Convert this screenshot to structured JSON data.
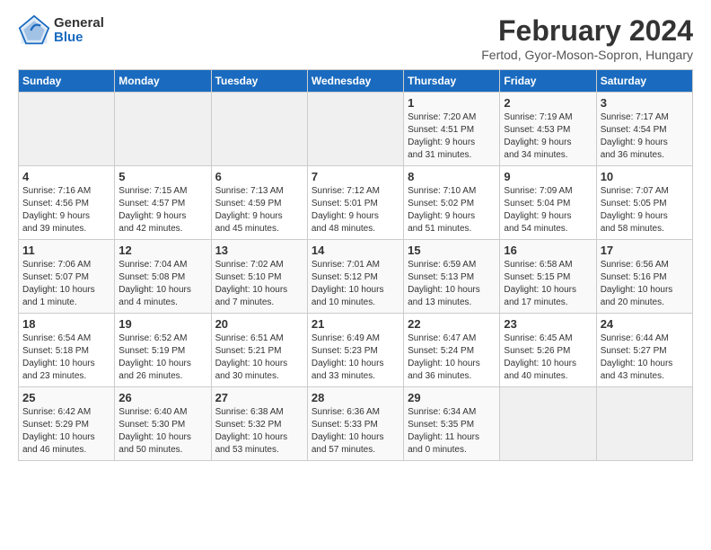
{
  "header": {
    "logo_general": "General",
    "logo_blue": "Blue",
    "title": "February 2024",
    "location": "Fertod, Gyor-Moson-Sopron, Hungary"
  },
  "calendar": {
    "days_of_week": [
      "Sunday",
      "Monday",
      "Tuesday",
      "Wednesday",
      "Thursday",
      "Friday",
      "Saturday"
    ],
    "weeks": [
      [
        {
          "day": "",
          "info": ""
        },
        {
          "day": "",
          "info": ""
        },
        {
          "day": "",
          "info": ""
        },
        {
          "day": "",
          "info": ""
        },
        {
          "day": "1",
          "info": "Sunrise: 7:20 AM\nSunset: 4:51 PM\nDaylight: 9 hours\nand 31 minutes."
        },
        {
          "day": "2",
          "info": "Sunrise: 7:19 AM\nSunset: 4:53 PM\nDaylight: 9 hours\nand 34 minutes."
        },
        {
          "day": "3",
          "info": "Sunrise: 7:17 AM\nSunset: 4:54 PM\nDaylight: 9 hours\nand 36 minutes."
        }
      ],
      [
        {
          "day": "4",
          "info": "Sunrise: 7:16 AM\nSunset: 4:56 PM\nDaylight: 9 hours\nand 39 minutes."
        },
        {
          "day": "5",
          "info": "Sunrise: 7:15 AM\nSunset: 4:57 PM\nDaylight: 9 hours\nand 42 minutes."
        },
        {
          "day": "6",
          "info": "Sunrise: 7:13 AM\nSunset: 4:59 PM\nDaylight: 9 hours\nand 45 minutes."
        },
        {
          "day": "7",
          "info": "Sunrise: 7:12 AM\nSunset: 5:01 PM\nDaylight: 9 hours\nand 48 minutes."
        },
        {
          "day": "8",
          "info": "Sunrise: 7:10 AM\nSunset: 5:02 PM\nDaylight: 9 hours\nand 51 minutes."
        },
        {
          "day": "9",
          "info": "Sunrise: 7:09 AM\nSunset: 5:04 PM\nDaylight: 9 hours\nand 54 minutes."
        },
        {
          "day": "10",
          "info": "Sunrise: 7:07 AM\nSunset: 5:05 PM\nDaylight: 9 hours\nand 58 minutes."
        }
      ],
      [
        {
          "day": "11",
          "info": "Sunrise: 7:06 AM\nSunset: 5:07 PM\nDaylight: 10 hours\nand 1 minute."
        },
        {
          "day": "12",
          "info": "Sunrise: 7:04 AM\nSunset: 5:08 PM\nDaylight: 10 hours\nand 4 minutes."
        },
        {
          "day": "13",
          "info": "Sunrise: 7:02 AM\nSunset: 5:10 PM\nDaylight: 10 hours\nand 7 minutes."
        },
        {
          "day": "14",
          "info": "Sunrise: 7:01 AM\nSunset: 5:12 PM\nDaylight: 10 hours\nand 10 minutes."
        },
        {
          "day": "15",
          "info": "Sunrise: 6:59 AM\nSunset: 5:13 PM\nDaylight: 10 hours\nand 13 minutes."
        },
        {
          "day": "16",
          "info": "Sunrise: 6:58 AM\nSunset: 5:15 PM\nDaylight: 10 hours\nand 17 minutes."
        },
        {
          "day": "17",
          "info": "Sunrise: 6:56 AM\nSunset: 5:16 PM\nDaylight: 10 hours\nand 20 minutes."
        }
      ],
      [
        {
          "day": "18",
          "info": "Sunrise: 6:54 AM\nSunset: 5:18 PM\nDaylight: 10 hours\nand 23 minutes."
        },
        {
          "day": "19",
          "info": "Sunrise: 6:52 AM\nSunset: 5:19 PM\nDaylight: 10 hours\nand 26 minutes."
        },
        {
          "day": "20",
          "info": "Sunrise: 6:51 AM\nSunset: 5:21 PM\nDaylight: 10 hours\nand 30 minutes."
        },
        {
          "day": "21",
          "info": "Sunrise: 6:49 AM\nSunset: 5:23 PM\nDaylight: 10 hours\nand 33 minutes."
        },
        {
          "day": "22",
          "info": "Sunrise: 6:47 AM\nSunset: 5:24 PM\nDaylight: 10 hours\nand 36 minutes."
        },
        {
          "day": "23",
          "info": "Sunrise: 6:45 AM\nSunset: 5:26 PM\nDaylight: 10 hours\nand 40 minutes."
        },
        {
          "day": "24",
          "info": "Sunrise: 6:44 AM\nSunset: 5:27 PM\nDaylight: 10 hours\nand 43 minutes."
        }
      ],
      [
        {
          "day": "25",
          "info": "Sunrise: 6:42 AM\nSunset: 5:29 PM\nDaylight: 10 hours\nand 46 minutes."
        },
        {
          "day": "26",
          "info": "Sunrise: 6:40 AM\nSunset: 5:30 PM\nDaylight: 10 hours\nand 50 minutes."
        },
        {
          "day": "27",
          "info": "Sunrise: 6:38 AM\nSunset: 5:32 PM\nDaylight: 10 hours\nand 53 minutes."
        },
        {
          "day": "28",
          "info": "Sunrise: 6:36 AM\nSunset: 5:33 PM\nDaylight: 10 hours\nand 57 minutes."
        },
        {
          "day": "29",
          "info": "Sunrise: 6:34 AM\nSunset: 5:35 PM\nDaylight: 11 hours\nand 0 minutes."
        },
        {
          "day": "",
          "info": ""
        },
        {
          "day": "",
          "info": ""
        }
      ]
    ]
  }
}
